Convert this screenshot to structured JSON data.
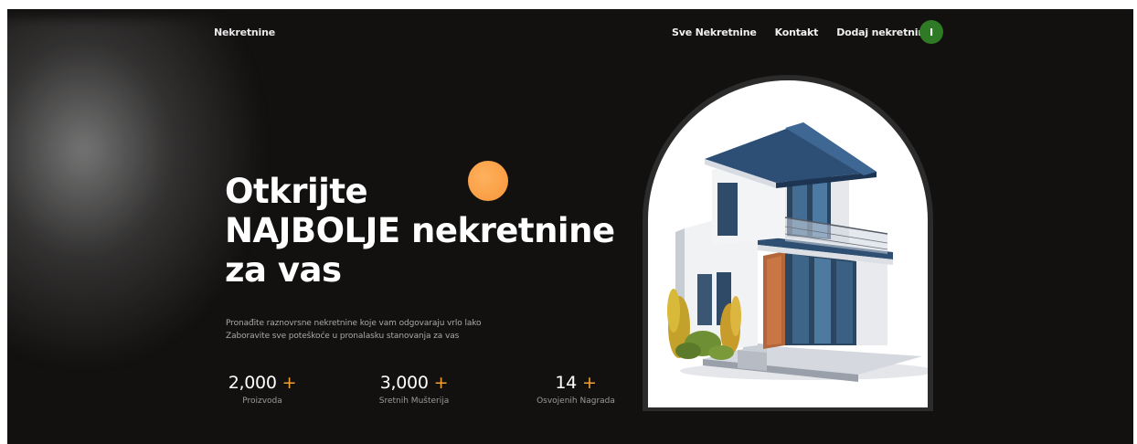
{
  "header": {
    "brand": "Nekretnine",
    "nav": [
      {
        "label": "Sve Nekretnine"
      },
      {
        "label": "Kontakt"
      },
      {
        "label": "Dodaj nekretninu"
      }
    ],
    "avatar_initial": "I",
    "avatar_color": "#2f7a24"
  },
  "hero": {
    "headline_line1": "Otkrijte",
    "headline_line2": "NAJBOLJE nekretnine",
    "headline_line3": "za vas",
    "subtext_line1": "Pronađite raznovrsne nekretnine koje vam odgovaraju vrlo lako",
    "subtext_line2": "Zaboravite sve poteškoće u pronalasku stanovanja za vas",
    "image_icon": "modern-house-image"
  },
  "stats": [
    {
      "value": "2,000",
      "suffix": "+",
      "label": "Proizvoda"
    },
    {
      "value": "3,000",
      "suffix": "+",
      "label": "Sretnih Mušterija"
    },
    {
      "value": "14",
      "suffix": "+",
      "label": "Osvojenih Nagrada"
    }
  ],
  "colors": {
    "background": "#131110",
    "accent": "#f5a132",
    "text": "#ffffff",
    "muted": "#a9a9a9"
  }
}
